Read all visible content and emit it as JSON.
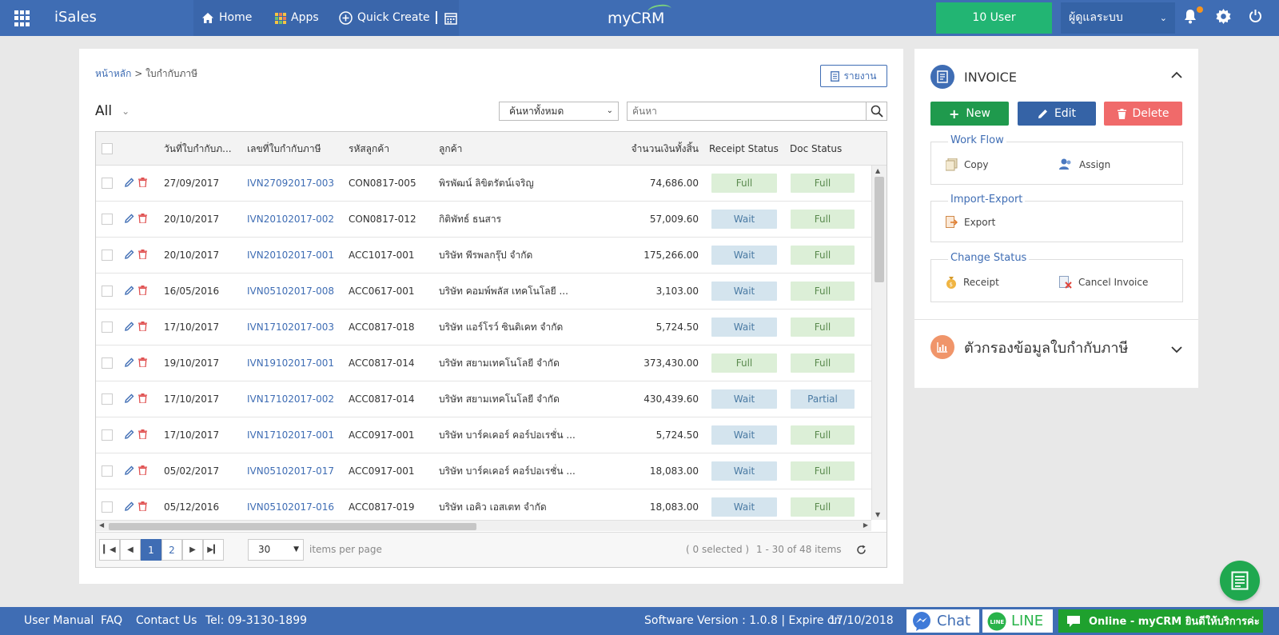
{
  "topbar": {
    "brand": "iSales",
    "menu": {
      "home": "Home",
      "apps": "Apps",
      "quick_create": "Quick Create"
    },
    "logo": "myCRM",
    "users_button": "10 User",
    "admin_select": "ผู้ดูแลระบบ"
  },
  "breadcrumb": {
    "home": "หน้าหลัก",
    "sep": ">",
    "current": "ใบกำกับภาษี"
  },
  "report_button": "รายงาน",
  "view_filter": "All",
  "search": {
    "scope": "ค้นหาทั้งหมด",
    "placeholder": "ค้นหา"
  },
  "table": {
    "columns": {
      "date": "วันที่ใบกำกับภ...",
      "number": "เลขที่ใบกำกับภาษี",
      "customer_code": "รหัสลูกค้า",
      "customer": "ลูกค้า",
      "total": "จำนวนเงินทั้งสิ้น",
      "receipt_status": "Receipt Status",
      "doc_status": "Doc Status"
    },
    "rows": [
      {
        "date": "27/09/2017",
        "number": "IVN27092017-003",
        "code": "CON0817-005",
        "customer": "พิรพัฒน์ ลิขิตรัตน์เจริญ",
        "total": "74,686.00",
        "receipt": "Full",
        "doc": "Full"
      },
      {
        "date": "20/10/2017",
        "number": "IVN20102017-002",
        "code": "CON0817-012",
        "customer": "กิติพัทธ์ ธนสาร",
        "total": "57,009.60",
        "receipt": "Wait",
        "doc": "Full"
      },
      {
        "date": "20/10/2017",
        "number": "IVN20102017-001",
        "code": "ACC1017-001",
        "customer": "บริษัท พีรพลกรุ๊ป จำกัด",
        "total": "175,266.00",
        "receipt": "Wait",
        "doc": "Full"
      },
      {
        "date": "16/05/2016",
        "number": "IVN05102017-008",
        "code": "ACC0617-001",
        "customer": "บริษัท คอมพ์พลัส เทคโนโลยี ...",
        "total": "3,103.00",
        "receipt": "Wait",
        "doc": "Full"
      },
      {
        "date": "17/10/2017",
        "number": "IVN17102017-003",
        "code": "ACC0817-018",
        "customer": "บริษัท แอร์โรว์ ซินดิเคท จำกัด",
        "total": "5,724.50",
        "receipt": "Wait",
        "doc": "Full"
      },
      {
        "date": "19/10/2017",
        "number": "IVN19102017-001",
        "code": "ACC0817-014",
        "customer": "บริษัท สยามเทคโนโลยี จำกัด",
        "total": "373,430.00",
        "receipt": "Full",
        "doc": "Full"
      },
      {
        "date": "17/10/2017",
        "number": "IVN17102017-002",
        "code": "ACC0817-014",
        "customer": "บริษัท สยามเทคโนโลยี จำกัด",
        "total": "430,439.60",
        "receipt": "Wait",
        "doc": "Partial"
      },
      {
        "date": "17/10/2017",
        "number": "IVN17102017-001",
        "code": "ACC0917-001",
        "customer": "บริษัท บาร์คเคอร์ คอร์ปอเรชั่น ...",
        "total": "5,724.50",
        "receipt": "Wait",
        "doc": "Full"
      },
      {
        "date": "05/02/2017",
        "number": "IVN05102017-017",
        "code": "ACC0917-001",
        "customer": "บริษัท บาร์คเคอร์ คอร์ปอเรชั่น ...",
        "total": "18,083.00",
        "receipt": "Wait",
        "doc": "Full"
      },
      {
        "date": "05/12/2016",
        "number": "IVN05102017-016",
        "code": "ACC0817-019",
        "customer": "บริษัท เอคิว เอสเตท จำกัด",
        "total": "18,083.00",
        "receipt": "Wait",
        "doc": "Full"
      }
    ]
  },
  "pager": {
    "pages": [
      "1",
      "2"
    ],
    "current_page": "1",
    "per_page": "30",
    "per_page_label": "items per page",
    "selected": "( 0 selected )",
    "range": "1 - 30 of 48 items"
  },
  "sidepanel": {
    "title": "INVOICE",
    "buttons": {
      "new": "New",
      "edit": "Edit",
      "delete": "Delete"
    },
    "workflow": {
      "title": "Work Flow",
      "copy": "Copy",
      "assign": "Assign"
    },
    "import_export": {
      "title": "Import-Export",
      "export": "Export"
    },
    "change_status": {
      "title": "Change Status",
      "receipt": "Receipt",
      "cancel": "Cancel Invoice"
    },
    "filter_title": "ตัวกรองข้อมูลใบกำกับภาษี"
  },
  "footer": {
    "manual": "User Manual",
    "faq": "FAQ",
    "contact": "Contact Us",
    "tel": "Tel: 09-3130-1899",
    "version": "Software Version : 1.0.8 | Expire on",
    "expire": "17/10/2018",
    "chat": "Chat",
    "line": "LINE",
    "online": "Online - myCRM ยินดีให้บริการค่ะ"
  },
  "colors": {
    "topbar": "#3f6db4",
    "users_button": "#22b573",
    "new_button": "#1f9a4d",
    "edit_button": "#3563a6",
    "delete_button": "#f06a6a",
    "status_full": "#dcefd7",
    "status_wait": "#d4e4ee"
  }
}
